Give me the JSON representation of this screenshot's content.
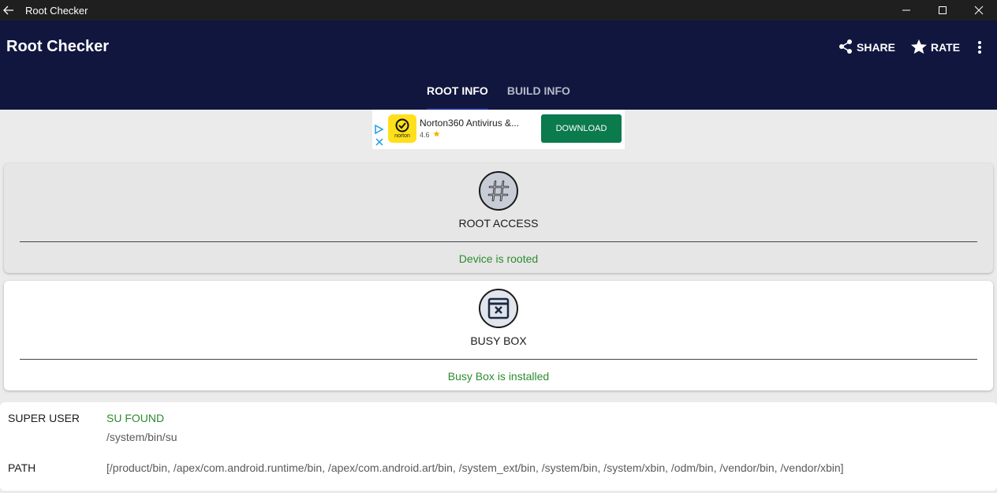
{
  "window": {
    "title": "Root Checker"
  },
  "appbar": {
    "title": "Root Checker",
    "share_label": "SHARE",
    "rate_label": "RATE"
  },
  "tabs": [
    {
      "label": "ROOT INFO",
      "active": true
    },
    {
      "label": "BUILD INFO",
      "active": false
    }
  ],
  "ad": {
    "title": "Norton360 Antivirus &...",
    "rating": "4.6",
    "button_label": "DOWNLOAD",
    "logo_text": "norton"
  },
  "root_card": {
    "label": "ROOT ACCESS",
    "status": "Device is rooted",
    "icon": "hash-icon"
  },
  "busybox_card": {
    "label": "BUSY BOX",
    "status": "Busy Box is installed",
    "icon": "busybox-icon"
  },
  "details": {
    "super_user_label": "SUPER USER",
    "super_user_status": "SU FOUND",
    "super_user_path": "/system/bin/su",
    "path_label": "PATH",
    "path_value": "[/product/bin, /apex/com.android.runtime/bin, /apex/com.android.art/bin, /system_ext/bin, /system/bin, /system/xbin, /odm/bin, /vendor/bin, /vendor/xbin]"
  },
  "colors": {
    "appbar": "#10163e",
    "status_green": "#2e8b2e",
    "ad_button": "#0b7a4d"
  }
}
